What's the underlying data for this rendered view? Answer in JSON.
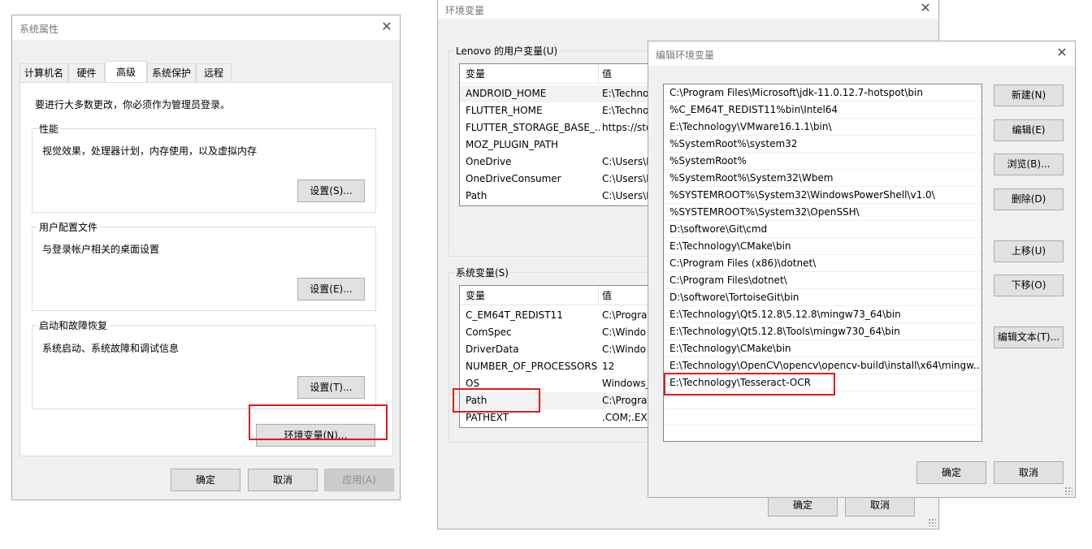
{
  "sys_props": {
    "title": "系统属性",
    "tabs": [
      "计算机名",
      "硬件",
      "高级",
      "系统保护",
      "远程"
    ],
    "admin_note": "要进行大多数更改，你必须作为管理员登录。",
    "performance": {
      "title": "性能",
      "desc": "视觉效果，处理器计划，内存使用，以及虚拟内存",
      "button": "设置(S)..."
    },
    "user_profiles": {
      "title": "用户配置文件",
      "desc": "与登录帐户相关的桌面设置",
      "button": "设置(E)..."
    },
    "startup": {
      "title": "启动和故障恢复",
      "desc": "系统启动、系统故障和调试信息",
      "button": "设置(T)..."
    },
    "env_button": "环境变量(N)...",
    "ok": "确定",
    "cancel": "取消",
    "apply": "应用(A)"
  },
  "env_vars": {
    "title": "环境变量",
    "user_group": "Lenovo 的用户变量(U)",
    "sys_group": "系统变量(S)",
    "col_var": "变量",
    "col_val": "值",
    "user_rows": [
      {
        "name": "ANDROID_HOME",
        "value": "E:\\Techno"
      },
      {
        "name": "FLUTTER_HOME",
        "value": "E:\\Techno"
      },
      {
        "name": "FLUTTER_STORAGE_BASE_...",
        "value": "https://sto"
      },
      {
        "name": "MOZ_PLUGIN_PATH",
        "value": ""
      },
      {
        "name": "OneDrive",
        "value": "C:\\Users\\L"
      },
      {
        "name": "OneDriveConsumer",
        "value": "C:\\Users\\L"
      },
      {
        "name": "Path",
        "value": "C:\\Users\\L"
      }
    ],
    "sys_rows": [
      {
        "name": "C_EM64T_REDIST11",
        "value": "C:\\Progra"
      },
      {
        "name": "ComSpec",
        "value": "C:\\Windo"
      },
      {
        "name": "DriverData",
        "value": "C:\\Windo"
      },
      {
        "name": "NUMBER_OF_PROCESSORS",
        "value": "12"
      },
      {
        "name": "OS",
        "value": "Windows_"
      },
      {
        "name": "Path",
        "value": "C:\\Progra"
      },
      {
        "name": "PATHEXT",
        "value": ".COM;.EXE"
      }
    ],
    "ok": "确定",
    "cancel": "取消"
  },
  "edit_env": {
    "title": "编辑环境变量",
    "entries": [
      "C:\\Program Files\\Microsoft\\jdk-11.0.12.7-hotspot\\bin",
      "%C_EM64T_REDIST11%bin\\Intel64",
      "E:\\Technology\\VMware16.1.1\\bin\\",
      "%SystemRoot%\\system32",
      "%SystemRoot%",
      "%SystemRoot%\\System32\\Wbem",
      "%SYSTEMROOT%\\System32\\WindowsPowerShell\\v1.0\\",
      "%SYSTEMROOT%\\System32\\OpenSSH\\",
      "D:\\softwore\\Git\\cmd",
      "E:\\Technology\\CMake\\bin",
      "C:\\Program Files (x86)\\dotnet\\",
      "C:\\Program Files\\dotnet\\",
      "D:\\softwore\\TortoiseGit\\bin",
      "E:\\Technology\\Qt5.12.8\\5.12.8\\mingw73_64\\bin",
      "E:\\Technology\\Qt5.12.8\\Tools\\mingw730_64\\bin",
      "E:\\Technology\\CMake\\bin",
      "E:\\Technology\\OpenCV\\opencv\\opencv-build\\install\\x64\\mingw...",
      "E:\\Technology\\Tesseract-OCR"
    ],
    "buttons": {
      "new": "新建(N)",
      "edit": "编辑(E)",
      "browse": "浏览(B)...",
      "delete": "删除(D)",
      "move_up": "上移(U)",
      "move_down": "下移(O)",
      "edit_text": "编辑文本(T)..."
    },
    "ok": "确定",
    "cancel": "取消"
  },
  "icons": {
    "close": "✕"
  },
  "colors": {
    "highlight": "#e01b1b",
    "selection": "#e5f3ff"
  }
}
